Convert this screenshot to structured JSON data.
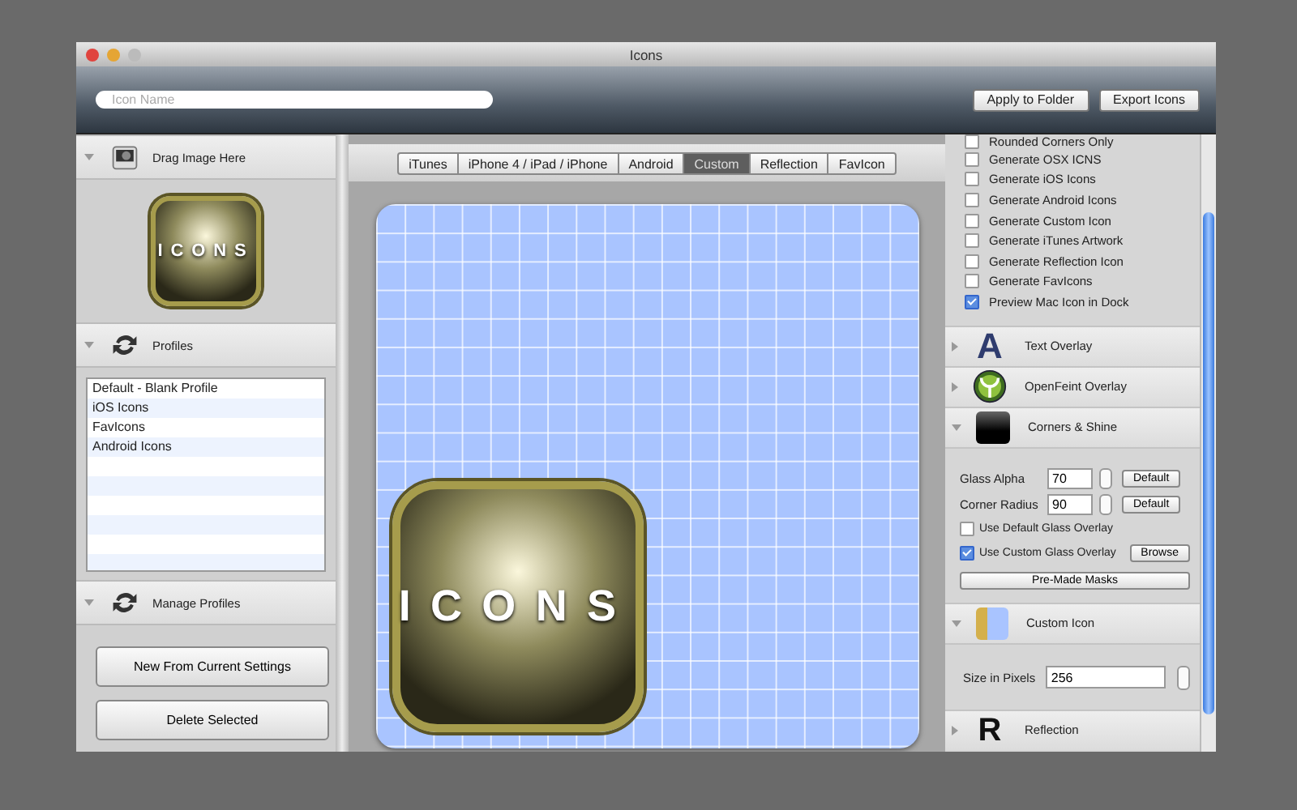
{
  "window": {
    "title": "Icons"
  },
  "toolbar": {
    "search": {
      "placeholder": "Icon Name"
    },
    "buttons": [
      "Apply to Folder",
      "Export Icons"
    ]
  },
  "left": {
    "drag": {
      "label": "Drag Image Here",
      "expanded": true,
      "preview_text": "ICONS"
    },
    "profiles": {
      "label": "Profiles",
      "expanded": true,
      "items": [
        {
          "label": "Default - Blank Profile",
          "selected": false
        },
        {
          "label": "iOS Icons",
          "selected": false
        },
        {
          "label": "FavIcons",
          "selected": false
        },
        {
          "label": "Android Icons",
          "selected": false
        }
      ]
    },
    "manage": {
      "label": "Manage Profiles",
      "expanded": true,
      "buttons": [
        "New From Current Settings",
        "Delete Selected"
      ]
    }
  },
  "tabs": [
    {
      "label": "iTunes",
      "selected": false
    },
    {
      "label": "iPhone 4 / iPad / iPhone",
      "selected": false
    },
    {
      "label": "Android",
      "selected": false
    },
    {
      "label": "Custom",
      "selected": true
    },
    {
      "label": "Reflection",
      "selected": false
    },
    {
      "label": "FavIcon",
      "selected": false
    }
  ],
  "canvas": {
    "icon_text": "ICONS"
  },
  "right": {
    "options": [
      {
        "label": "Rounded Corners Only",
        "checked": false
      },
      {
        "label": "Generate OSX ICNS",
        "checked": false
      },
      {
        "label": "Generate iOS Icons",
        "checked": false
      },
      {
        "label": "Generate Android Icons",
        "checked": false
      },
      {
        "label": "Generate Custom Icon",
        "checked": false
      },
      {
        "label": "Generate iTunes Artwork",
        "checked": false
      },
      {
        "label": "Generate Reflection Icon",
        "checked": false
      },
      {
        "label": "Generate FavIcons",
        "checked": false
      },
      {
        "label": "Preview Mac Icon in Dock",
        "checked": true
      }
    ],
    "sections": [
      {
        "kind": "text_overlay",
        "title": "Text Overlay",
        "expanded": false,
        "glyph": "A"
      },
      {
        "kind": "openfeint",
        "title": "OpenFeint Overlay",
        "expanded": false
      },
      {
        "kind": "corners",
        "title": "Corners & Shine",
        "expanded": true,
        "fields": [
          {
            "label": "Glass Alpha",
            "value": "70",
            "button": "Default"
          },
          {
            "label": "Corner Radius",
            "value": "90",
            "button": "Default"
          }
        ],
        "checks": [
          {
            "label": "Use Default Glass Overlay",
            "checked": false
          },
          {
            "label": "Use Custom Glass Overlay",
            "checked": true
          }
        ],
        "browse": "Browse",
        "masks": "Pre-Made Masks"
      },
      {
        "kind": "custom",
        "title": "Custom Icon",
        "expanded": true,
        "size_label": "Size in Pixels",
        "size_value": "256"
      },
      {
        "kind": "reflection",
        "title": "Reflection",
        "expanded": false,
        "glyph": "R"
      }
    ]
  }
}
